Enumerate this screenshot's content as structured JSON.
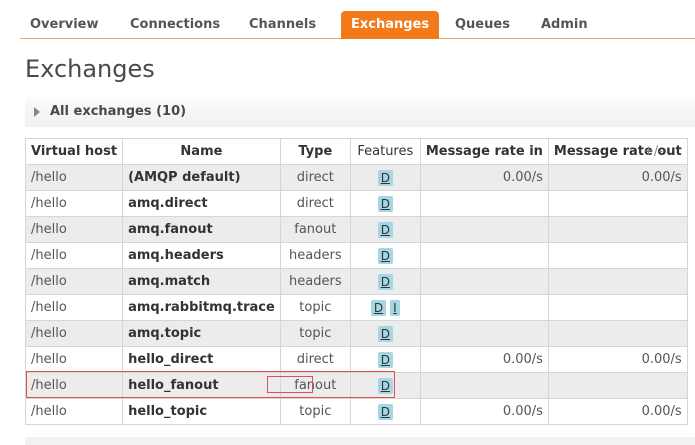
{
  "nav": {
    "tabs": [
      {
        "label": "Overview"
      },
      {
        "label": "Connections"
      },
      {
        "label": "Channels"
      },
      {
        "label": "Exchanges",
        "active": true
      },
      {
        "label": "Queues"
      },
      {
        "label": "Admin"
      }
    ]
  },
  "page": {
    "title": "Exchanges",
    "section_label": "All exchanges (10)"
  },
  "table": {
    "headers": {
      "virtual_host": "Virtual host",
      "name": "Name",
      "type": "Type",
      "features": "Features",
      "rate_in": "Message rate in",
      "rate_out": "Message rate out"
    },
    "plus_minus": "+/-",
    "rows": [
      {
        "vhost": "/hello",
        "name": "(AMQP default)",
        "type": "direct",
        "features": [
          "D"
        ],
        "rate_in": "0.00/s",
        "rate_out": "0.00/s"
      },
      {
        "vhost": "/hello",
        "name": "amq.direct",
        "type": "direct",
        "features": [
          "D"
        ],
        "rate_in": "",
        "rate_out": ""
      },
      {
        "vhost": "/hello",
        "name": "amq.fanout",
        "type": "fanout",
        "features": [
          "D"
        ],
        "rate_in": "",
        "rate_out": ""
      },
      {
        "vhost": "/hello",
        "name": "amq.headers",
        "type": "headers",
        "features": [
          "D"
        ],
        "rate_in": "",
        "rate_out": ""
      },
      {
        "vhost": "/hello",
        "name": "amq.match",
        "type": "headers",
        "features": [
          "D"
        ],
        "rate_in": "",
        "rate_out": ""
      },
      {
        "vhost": "/hello",
        "name": "amq.rabbitmq.trace",
        "type": "topic",
        "features": [
          "D",
          "I"
        ],
        "rate_in": "",
        "rate_out": ""
      },
      {
        "vhost": "/hello",
        "name": "amq.topic",
        "type": "topic",
        "features": [
          "D"
        ],
        "rate_in": "",
        "rate_out": ""
      },
      {
        "vhost": "/hello",
        "name": "hello_direct",
        "type": "direct",
        "features": [
          "D"
        ],
        "rate_in": "0.00/s",
        "rate_out": "0.00/s"
      },
      {
        "vhost": "/hello",
        "name": "hello_fanout",
        "type": "fanout",
        "features": [
          "D"
        ],
        "rate_in": "",
        "rate_out": "",
        "highlighted": true
      },
      {
        "vhost": "/hello",
        "name": "hello_topic",
        "type": "topic",
        "features": [
          "D"
        ],
        "rate_in": "0.00/s",
        "rate_out": "0.00/s"
      }
    ]
  },
  "colors": {
    "accent": "#f27a1a",
    "feature_tag": "#a4d7e3",
    "highlight": "#e05050"
  }
}
